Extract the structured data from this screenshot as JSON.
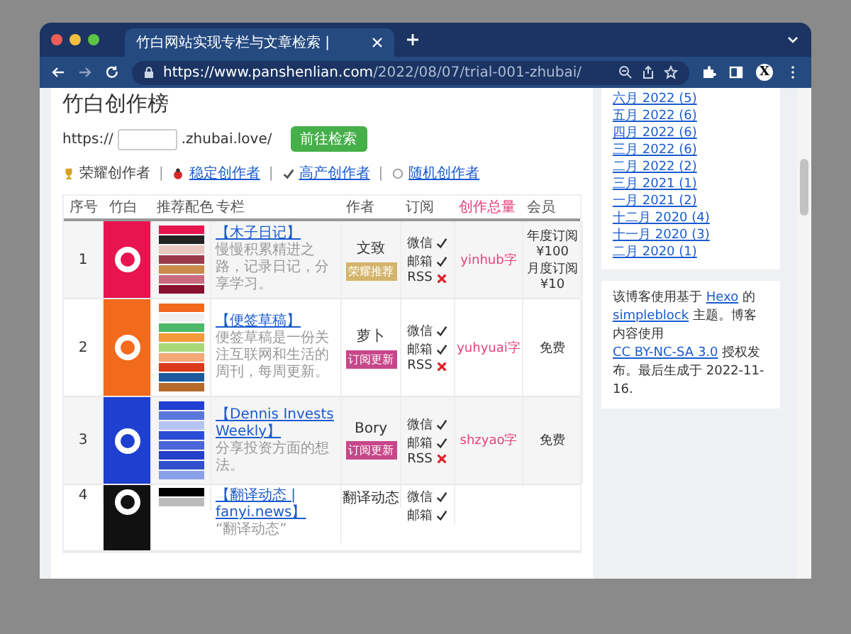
{
  "browser": {
    "tab_title": "竹白网站实现专栏与文章检索 |",
    "url_host": "https://www.panshenlian.com",
    "url_path": "/2022/08/07/trial-001-zhubai/",
    "profile_letter": "X"
  },
  "page": {
    "title": "竹白创作榜",
    "form": {
      "prefix": "https://",
      "suffix": ".zhubai.love/",
      "button": "前往检索"
    },
    "separator": "|",
    "filters": [
      {
        "kind": "trophy",
        "label": "荣耀创作者",
        "selected": true
      },
      {
        "kind": "ladybug",
        "label": "稳定创作者",
        "selected": false
      },
      {
        "kind": "check",
        "label": "高产创作者",
        "selected": false
      },
      {
        "kind": "circle",
        "label": "随机创作者",
        "selected": false
      }
    ],
    "table": {
      "columns": [
        {
          "label": "序号",
          "highlight": false
        },
        {
          "label": "竹白",
          "highlight": false
        },
        {
          "label": "推荐配色",
          "highlight": false
        },
        {
          "label": "专栏",
          "highlight": false
        },
        {
          "label": "作者",
          "highlight": false
        },
        {
          "label": "订阅",
          "highlight": false
        },
        {
          "label": "创作总量",
          "highlight": true
        },
        {
          "label": "会员",
          "highlight": false
        }
      ],
      "rows": [
        {
          "index": "1",
          "logo": {
            "color": "#e8144f"
          },
          "palette": [
            {
              "color": "#e8144f"
            },
            {
              "color": "#222222"
            },
            {
              "color": "#e8c8c0"
            },
            {
              "color": "#9a3a4a"
            },
            {
              "color": "#c98a4a"
            },
            {
              "color": "#c96a80"
            },
            {
              "color": "#8a1030"
            }
          ],
          "title": "【木子日记】",
          "description": "慢慢积累精进之路，记录日记，分享学习。",
          "author": "文致",
          "badge": {
            "label": "荣耀推荐",
            "color": "#d4b46a"
          },
          "subscribe": [
            {
              "label": "微信",
              "available": true
            },
            {
              "label": "邮箱",
              "available": true
            },
            {
              "label": "RSS",
              "available": false
            }
          ],
          "count": "yinhub字",
          "member": [
            "年度订阅 ¥100",
            "月度订阅 ¥10"
          ]
        },
        {
          "index": "2",
          "logo": {
            "color": "#f26a1c"
          },
          "palette": [
            {
              "color": "#f26a1c"
            },
            {
              "color": "#f0f0f0"
            },
            {
              "color": "#4cb86a"
            },
            {
              "color": "#f39a3a"
            },
            {
              "color": "#a8d878"
            },
            {
              "color": "#f4a878"
            },
            {
              "color": "#d83a1a"
            },
            {
              "color": "#1c5aa0"
            },
            {
              "color": "#b86a2a"
            }
          ],
          "title": "【便签草稿】",
          "description": "便签草稿是一份关注互联网和生活的周刊，每周更新。",
          "author": "萝卜",
          "badge": {
            "label": "订阅更新",
            "color": "#c8468a"
          },
          "subscribe": [
            {
              "label": "微信",
              "available": true
            },
            {
              "label": "邮箱",
              "available": true
            },
            {
              "label": "RSS",
              "available": false
            }
          ],
          "count": "yuhyuai字",
          "member": [
            "免费"
          ]
        },
        {
          "index": "3",
          "logo": {
            "color": "#1f3fd0"
          },
          "palette": [
            {
              "color": "#1f3fd0"
            },
            {
              "color": "#5a78dc"
            },
            {
              "color": "#b4c4f4"
            },
            {
              "color": "#2a4cd4"
            },
            {
              "color": "#4a66d8"
            },
            {
              "color": "#2440c8"
            },
            {
              "color": "#3050d0"
            },
            {
              "color": "#8aa0e8"
            }
          ],
          "title": "【Dennis Invests Weekly】",
          "description": "分享投资方面的想法。",
          "author": "Bory",
          "badge": {
            "label": "订阅更新",
            "color": "#c8468a"
          },
          "subscribe": [
            {
              "label": "微信",
              "available": true
            },
            {
              "label": "邮箱",
              "available": true
            },
            {
              "label": "RSS",
              "available": false
            }
          ],
          "count": "shzyao字",
          "member": [
            "免费"
          ]
        },
        {
          "index": "4",
          "logo": {
            "color": "#111111"
          },
          "palette": [
            {
              "color": "#000000"
            },
            {
              "color": "#bbbbbb"
            }
          ],
          "title": "【翻译动态 | fanyi.news】",
          "description": "“翻译动态”",
          "author": "翻译动态",
          "subscribe": [
            {
              "label": "微信",
              "available": true
            },
            {
              "label": "邮箱",
              "available": true
            }
          ],
          "member": []
        }
      ]
    }
  },
  "sidebar": {
    "archives": [
      "六月 2022 (5)",
      "五月 2022 (6)",
      "四月 2022 (6)",
      "三月 2022 (6)",
      "二月 2022 (2)",
      "三月 2021 (1)",
      "一月 2021 (2)",
      "十二月 2020 (4)",
      "十一月 2020 (3)",
      "二月 2020 (1)"
    ],
    "footer": {
      "parts": [
        {
          "kind": "text",
          "text": "该博客使用基于"
        },
        {
          "kind": "link",
          "text": "Hexo"
        },
        {
          "kind": "text",
          "text": "的"
        },
        {
          "kind": "link",
          "text": "simpleblock"
        },
        {
          "kind": "text",
          "text": "主题。博客内容使用"
        },
        {
          "kind": "link",
          "text": "CC BY-NC-SA 3.0"
        },
        {
          "kind": "text",
          "text": "授权发布。最后生成于 2022-11-16."
        }
      ]
    }
  }
}
